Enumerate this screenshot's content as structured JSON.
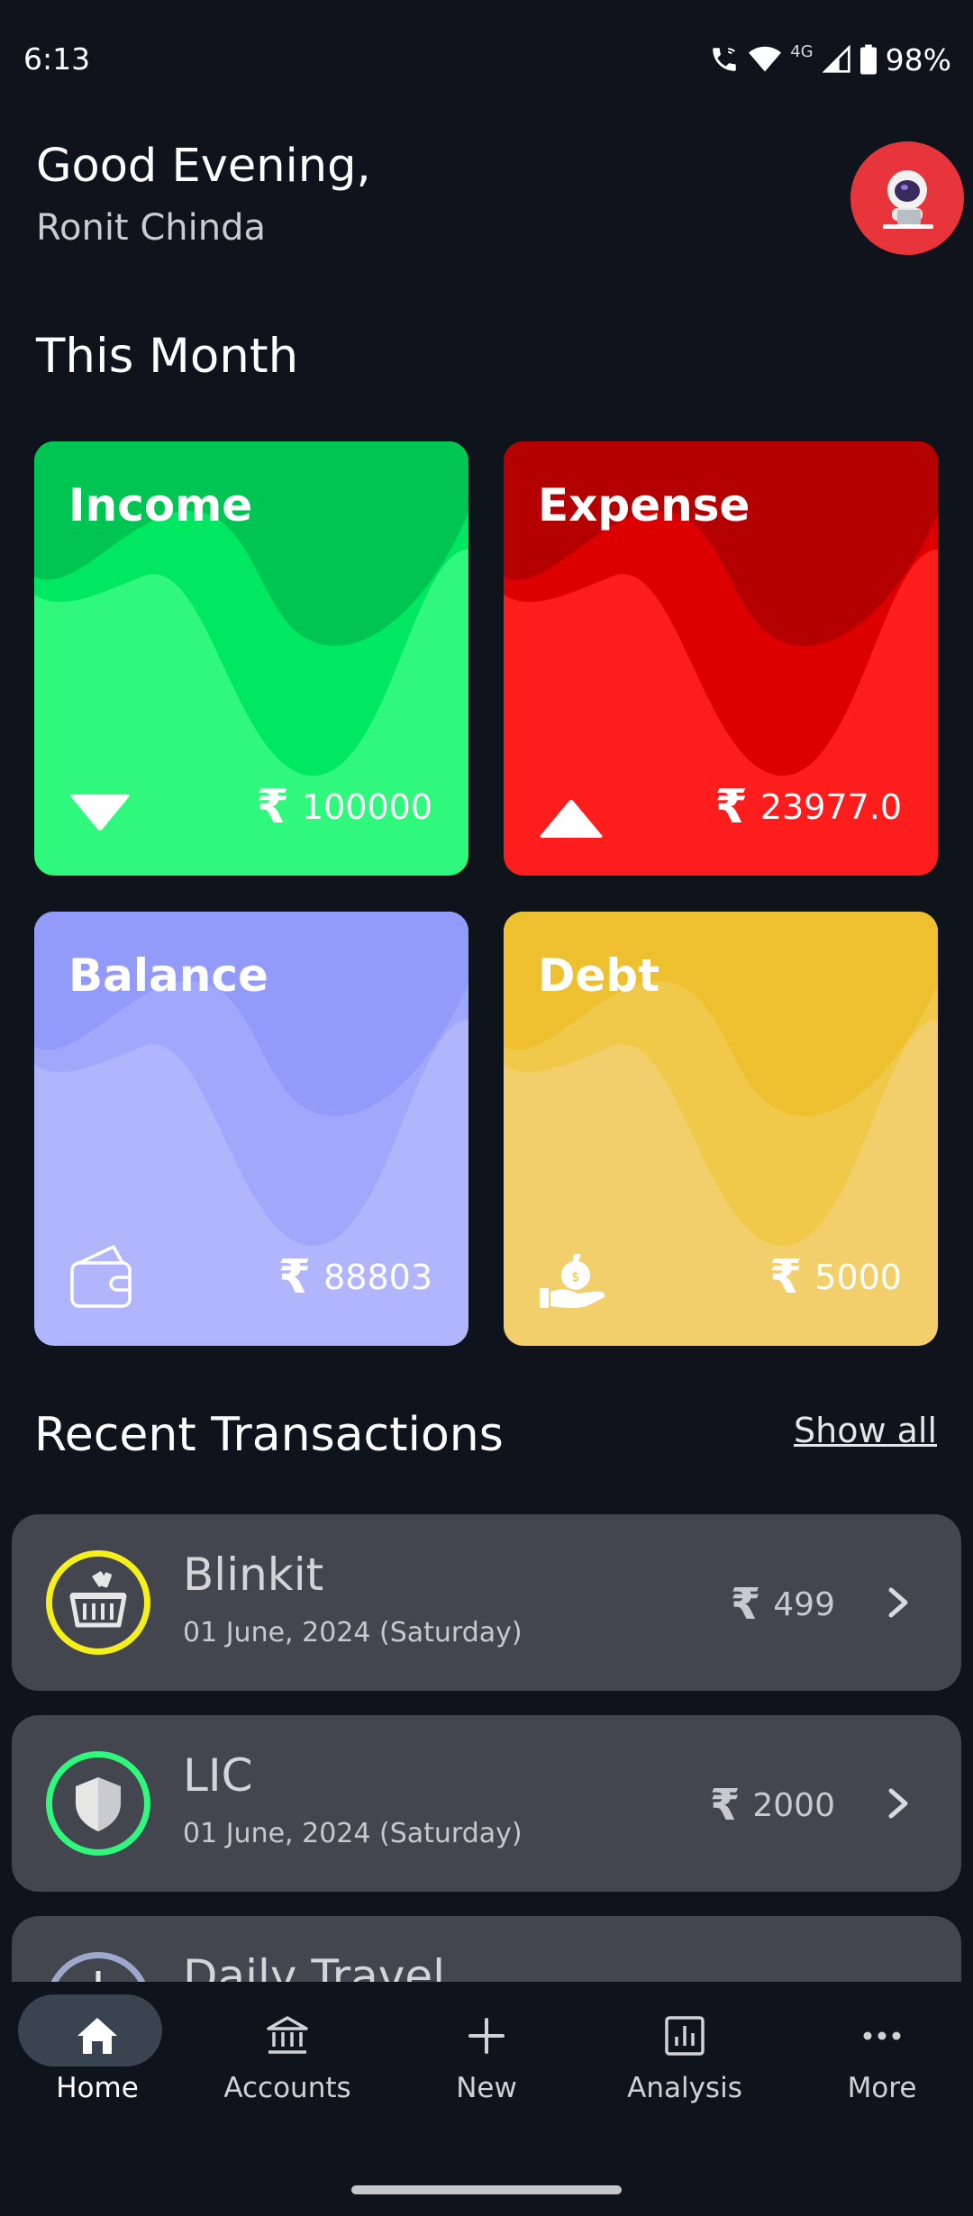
{
  "status_bar": {
    "time": "6:13",
    "network": "4G",
    "battery": "98%"
  },
  "header": {
    "greeting": "Good Evening,",
    "user_name": "Ronit Chinda"
  },
  "this_month": {
    "title": "This Month",
    "cards": {
      "income": {
        "label": "Income",
        "currency": "₹",
        "amount": "100000",
        "color": "#2ff87c"
      },
      "expense": {
        "label": "Expense",
        "currency": "₹",
        "amount": "23977.0",
        "color": "#fe1d1d"
      },
      "balance": {
        "label": "Balance",
        "currency": "₹",
        "amount": "88803",
        "color": "#aeb3fb"
      },
      "debt": {
        "label": "Debt",
        "currency": "₹",
        "amount": "5000",
        "color": "#f1cf68"
      }
    }
  },
  "recent": {
    "title": "Recent Transactions",
    "show_all": "Show all",
    "items": [
      {
        "name": "Blinkit",
        "date": "01 June, 2024 (Saturday)",
        "currency": "₹",
        "amount": "499",
        "icon": "basket-icon",
        "ring_color": "#f5ef1c"
      },
      {
        "name": "LIC",
        "date": "01 June, 2024 (Saturday)",
        "currency": "₹",
        "amount": "2000",
        "icon": "shield-icon",
        "ring_color": "#2ff87c"
      },
      {
        "name": "Daily Travel",
        "icon": "clock-icon",
        "ring_color": "#9ea7cc"
      }
    ]
  },
  "nav": {
    "items": [
      {
        "label": "Home",
        "icon": "home-icon",
        "active": true
      },
      {
        "label": "Accounts",
        "icon": "bank-icon"
      },
      {
        "label": "New",
        "icon": "plus-icon"
      },
      {
        "label": "Analysis",
        "icon": "analytics-icon"
      },
      {
        "label": "More",
        "icon": "more-icon"
      }
    ]
  }
}
